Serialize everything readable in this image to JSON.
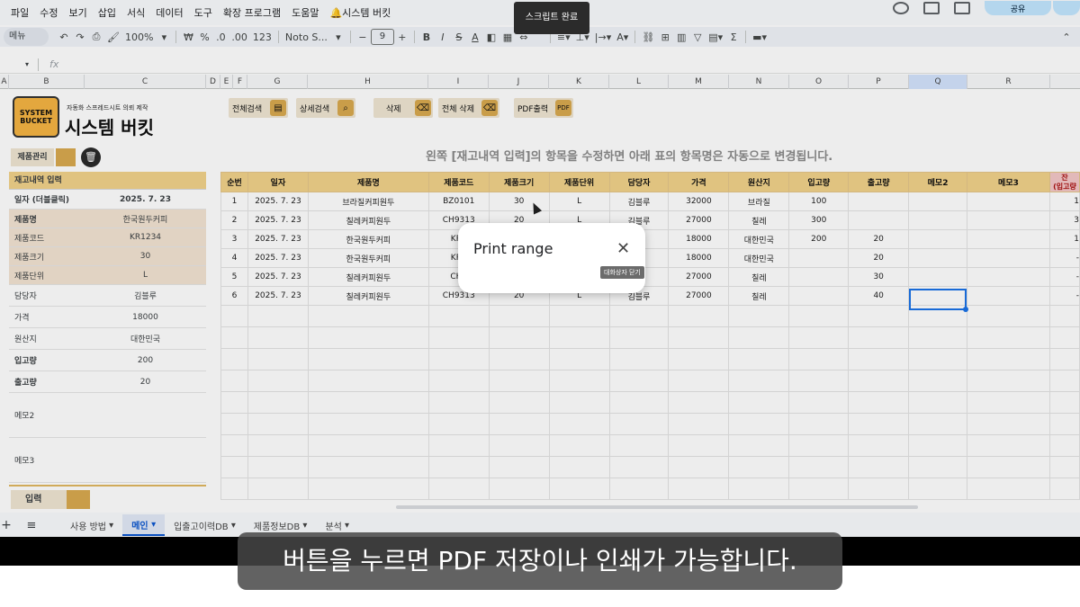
{
  "menubar": {
    "items": [
      "파일",
      "수정",
      "보기",
      "삽입",
      "서식",
      "데이터",
      "도구",
      "확장 프로그램",
      "도움말",
      "🔔시스템 버킷"
    ],
    "share_label": "공유"
  },
  "toolbar": {
    "menu_search": "메뉴",
    "zoom": "100%",
    "currency": "₩",
    "percent": "%",
    "dec_less": ".0",
    "dec_more": ".00",
    "num_format": "123",
    "font": "Noto S...",
    "font_size": "9",
    "minus": "−",
    "plus": "+",
    "bold": "B",
    "italic": "I",
    "strike": "S",
    "text_color": "A"
  },
  "formula_bar": {
    "name_box": "",
    "fx": "fx"
  },
  "columns": [
    "A",
    "B",
    "C",
    "D",
    "E",
    "F",
    "G",
    "H",
    "I",
    "J",
    "K",
    "L",
    "M",
    "N",
    "O",
    "P",
    "Q",
    "R"
  ],
  "toast": "스크립트 완료",
  "header": {
    "logo_line1": "SYSTEM",
    "logo_line2": "BUCKET",
    "subtitle": "자동화 스프레드시트 의뢰 제작",
    "title": "시스템 버킷"
  },
  "buttons": {
    "full_search": "전체검색",
    "detail_search": "상세검색",
    "delete": "삭제",
    "delete_all": "전체 삭제",
    "pdf_print": "PDF출력",
    "product_mgmt": "제품관리",
    "register": "입력"
  },
  "notice": "왼쪽 [재고내역 입력]의 항목을 수정하면 아래 표의 항목명은 자동으로 변경됩니다.",
  "form": {
    "header": "재고내역 입력",
    "rows": [
      {
        "key": "일자 (더블클릭)",
        "value": "2025. 7. 23"
      },
      {
        "key": "제품명",
        "value": "한국원두커피"
      },
      {
        "key": "제품코드",
        "value": "KR1234"
      },
      {
        "key": "제품크기",
        "value": "30"
      },
      {
        "key": "제품단위",
        "value": "L"
      },
      {
        "key": "담당자",
        "value": "김블루"
      },
      {
        "key": "가격",
        "value": "18000"
      },
      {
        "key": "원산지",
        "value": "대한민국"
      },
      {
        "key": "입고량",
        "value": "200"
      },
      {
        "key": "출고량",
        "value": "20"
      },
      {
        "key": "메모2",
        "value": ""
      },
      {
        "key": "메모3",
        "value": ""
      }
    ]
  },
  "table": {
    "headers": [
      "순번",
      "일자",
      "제품명",
      "제품코드",
      "제품크기",
      "제품단위",
      "담당자",
      "가격",
      "원산지",
      "입고량",
      "출고량",
      "메모2",
      "메모3",
      "잔"
    ],
    "rows": [
      [
        "1",
        "2025. 7. 23",
        "브라질커피원두",
        "BZ0101",
        "30",
        "L",
        "김블루",
        "32000",
        "브라질",
        "100",
        "",
        "",
        "",
        "1"
      ],
      [
        "2",
        "2025. 7. 23",
        "칠레커피원두",
        "CH9313",
        "20",
        "L",
        "김블루",
        "27000",
        "칠레",
        "300",
        "",
        "",
        "",
        "3"
      ],
      [
        "3",
        "2025. 7. 23",
        "한국원두커피",
        "KR1",
        "",
        "",
        "루",
        "18000",
        "대한민국",
        "200",
        "20",
        "",
        "",
        "1"
      ],
      [
        "4",
        "2025. 7. 23",
        "한국원두커피",
        "KR1",
        "",
        "",
        "루",
        "18000",
        "대한민국",
        "",
        "20",
        "",
        "",
        "-"
      ],
      [
        "5",
        "2025. 7. 23",
        "칠레커피원두",
        "CH9",
        "",
        "",
        "루",
        "27000",
        "칠레",
        "",
        "30",
        "",
        "",
        "-"
      ],
      [
        "6",
        "2025. 7. 23",
        "칠레커피원두",
        "CH9313",
        "20",
        "L",
        "김블루",
        "27000",
        "칠레",
        "",
        "40",
        "",
        "",
        "-"
      ]
    ],
    "last_header_sub": "(입고량"
  },
  "dialog": {
    "title": "Print range",
    "close_tooltip": "대화상자 닫기"
  },
  "sheet_tabs": [
    "사용 방법",
    "메인",
    "입출고이력DB",
    "제품정보DB",
    "분석"
  ],
  "caption": "버튼을 누르면 PDF 저장이나 인쇄가 가능합니다."
}
